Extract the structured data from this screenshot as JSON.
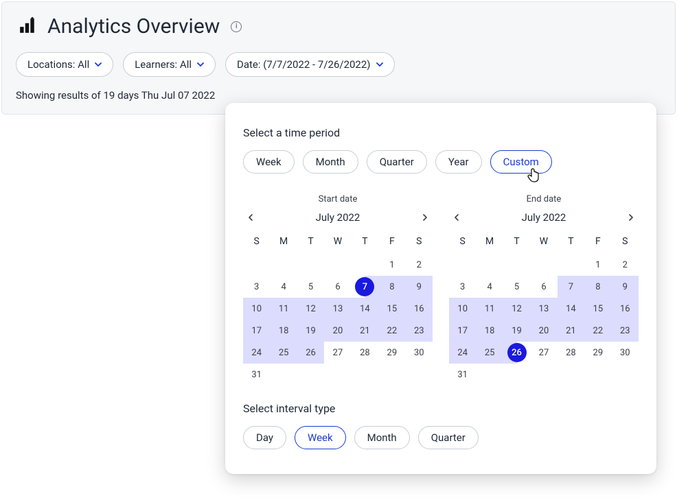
{
  "header": {
    "title": "Analytics Overview"
  },
  "filters": {
    "locations": "Locations: All",
    "learners": "Learners: All",
    "date": "Date: (7/7/2022 - 7/26/2022)"
  },
  "results_text": "Showing results of 19 days Thu Jul 07 2022",
  "popover": {
    "period_label": "Select a time period",
    "periods": {
      "week": "Week",
      "month": "Month",
      "quarter": "Quarter",
      "year": "Year",
      "custom": "Custom"
    },
    "selected_period": "custom",
    "interval_label": "Select interval type",
    "intervals": {
      "day": "Day",
      "week": "Week",
      "month": "Month",
      "quarter": "Quarter"
    },
    "selected_interval": "week",
    "start": {
      "title": "Start date",
      "month": "July 2022",
      "dow": [
        "S",
        "M",
        "T",
        "W",
        "T",
        "F",
        "S"
      ],
      "blanks": 5,
      "days": 31,
      "selected": 7,
      "range_from": 7,
      "range_to": 26
    },
    "end": {
      "title": "End date",
      "month": "July 2022",
      "dow": [
        "S",
        "M",
        "T",
        "W",
        "T",
        "F",
        "S"
      ],
      "blanks": 5,
      "days": 31,
      "selected": 26,
      "range_from": 7,
      "range_to": 26
    }
  },
  "colors": {
    "accent": "#1a3ad3",
    "circle": "#1a19de",
    "range": "#dcdcff"
  }
}
